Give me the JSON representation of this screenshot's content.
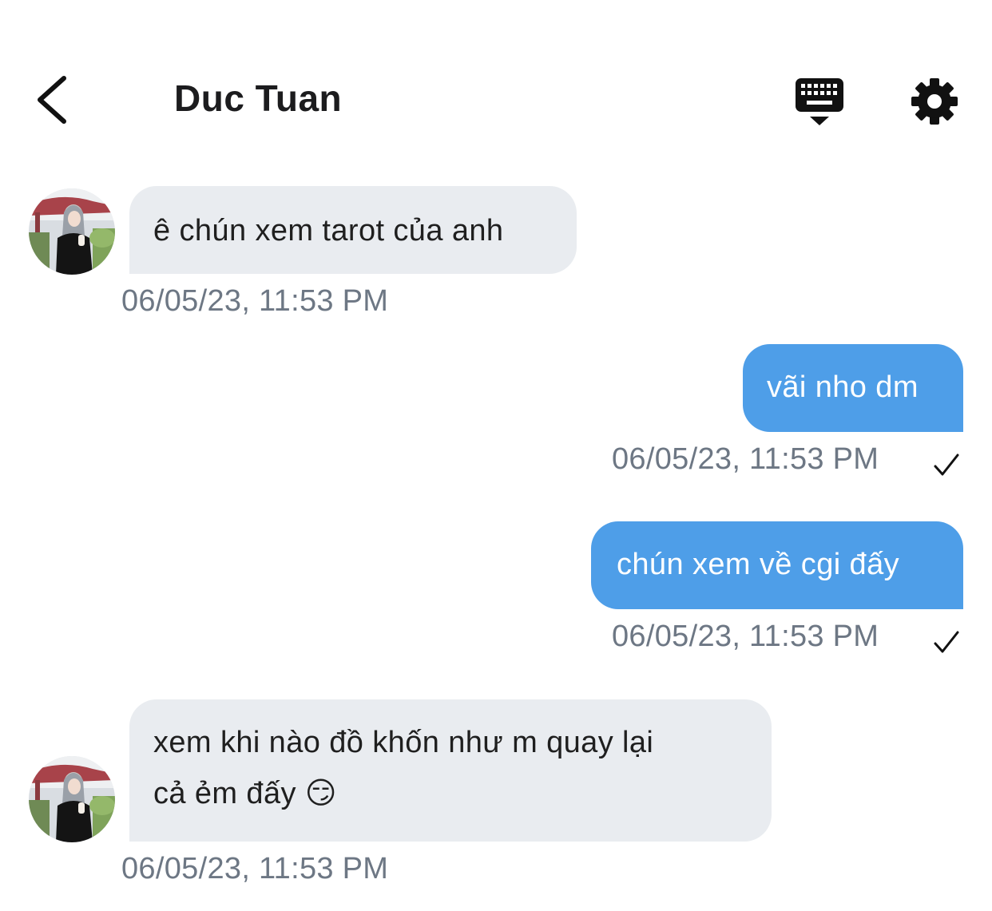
{
  "header": {
    "title": "Duc Tuan"
  },
  "messages": [
    {
      "direction": "in",
      "text": "ê chún xem tarot của anh",
      "time": "06/05/23, 11:53 PM"
    },
    {
      "direction": "out",
      "text": "vãi nho dm",
      "time": "06/05/23, 11:53 PM",
      "status": "sent-check-icon"
    },
    {
      "direction": "out",
      "text": "chún xem về cgi đấy",
      "time": "06/05/23, 11:53 PM",
      "status": "sent-check-icon"
    },
    {
      "direction": "in",
      "line1": "xem khi nào đồ khốn như m quay lại",
      "line2": "cả ẻm đấy 😏",
      "time": "06/05/23, 11:53 PM"
    }
  ],
  "colors": {
    "incoming_bubble": "#e9ecf0",
    "outgoing_bubble": "#4e9ee8",
    "timestamp": "#6d7784"
  }
}
